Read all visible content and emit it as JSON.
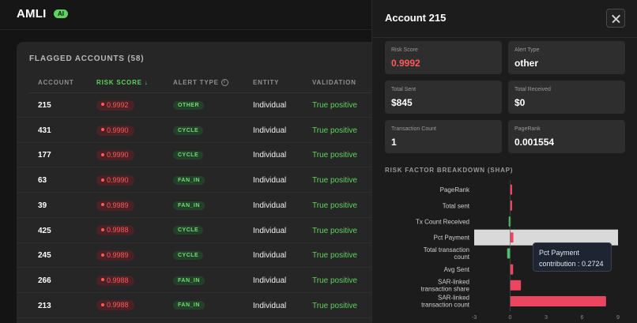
{
  "app": {
    "name": "AMLI",
    "badge": "AI"
  },
  "table": {
    "title": "FLAGGED ACCOUNTS (58)",
    "headers": {
      "account": "ACCOUNT",
      "risk_score": "RISK SCORE ↓",
      "alert_type": "ALERT TYPE",
      "entity": "ENTITY",
      "validation": "VALIDATION"
    },
    "rows": [
      {
        "account": "215",
        "risk_score": "0.9992",
        "alert_type": "OTHER",
        "entity": "Individual",
        "validation": "True positive"
      },
      {
        "account": "431",
        "risk_score": "0.9990",
        "alert_type": "CYCLE",
        "entity": "Individual",
        "validation": "True positive"
      },
      {
        "account": "177",
        "risk_score": "0.9990",
        "alert_type": "CYCLE",
        "entity": "Individual",
        "validation": "True positive"
      },
      {
        "account": "63",
        "risk_score": "0.9990",
        "alert_type": "FAN_IN",
        "entity": "Individual",
        "validation": "True positive"
      },
      {
        "account": "39",
        "risk_score": "0.9989",
        "alert_type": "FAN_IN",
        "entity": "Individual",
        "validation": "True positive"
      },
      {
        "account": "425",
        "risk_score": "0.9988",
        "alert_type": "CYCLE",
        "entity": "Individual",
        "validation": "True positive"
      },
      {
        "account": "245",
        "risk_score": "0.9989",
        "alert_type": "CYCLE",
        "entity": "Individual",
        "validation": "True positive"
      },
      {
        "account": "266",
        "risk_score": "0.9988",
        "alert_type": "FAN_IN",
        "entity": "Individual",
        "validation": "True positive"
      },
      {
        "account": "213",
        "risk_score": "0.9988",
        "alert_type": "FAN_IN",
        "entity": "Individual",
        "validation": "True positive"
      }
    ]
  },
  "panel": {
    "title": "Account 215",
    "stats": {
      "risk_score": {
        "label": "Risk Score",
        "value": "0.9992"
      },
      "alert_type": {
        "label": "Alert Type",
        "value": "other"
      },
      "total_sent": {
        "label": "Total Sent",
        "value": "$845"
      },
      "total_received": {
        "label": "Total Received",
        "value": "$0"
      },
      "tx_count": {
        "label": "Transaction Count",
        "value": "1"
      },
      "pagerank": {
        "label": "PageRank",
        "value": "0.001554"
      }
    },
    "shap_title": "RISK FACTOR BREAKDOWN (SHAP)",
    "tooltip": {
      "name": "Pct Payment",
      "value": "contribution : 0.2724"
    }
  },
  "colors": {
    "positive": "#ec4560",
    "negative": "#4cc36a",
    "accent_green": "#5fd35f",
    "risk_red": "#ff5a5a"
  },
  "chart_data": {
    "type": "bar",
    "orientation": "horizontal",
    "categories": [
      [
        "PageRank"
      ],
      [
        "Total sent"
      ],
      [
        "Tx Count Received"
      ],
      [
        "Pct Payment"
      ],
      [
        "Total transaction",
        "count"
      ],
      [
        "Avg Sent"
      ],
      [
        "SAR-linked",
        "transaction share"
      ],
      [
        "SAR-linked",
        "transaction count"
      ]
    ],
    "values": [
      0.12,
      0.15,
      -0.12,
      0.2724,
      -0.25,
      0.25,
      0.9,
      8.0
    ],
    "highlighted_index": 3,
    "x_ticks": [
      -3,
      0,
      3,
      6,
      9
    ],
    "xlim": [
      -3,
      9
    ]
  }
}
